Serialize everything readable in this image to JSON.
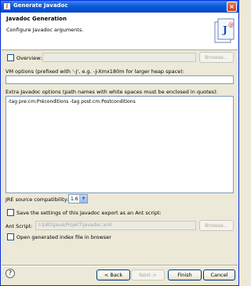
{
  "window": {
    "title": "Generate Javadoc"
  },
  "header": {
    "title": "Javadoc Generation",
    "subtitle": "Configure Javadoc arguments."
  },
  "overview": {
    "label": "Overview:",
    "value": "",
    "browse_label": "Browse..."
  },
  "vm_options": {
    "label": "VM options (prefixed with '-J', e.g. -J-Xmx180m for larger heap space):",
    "value": ""
  },
  "extra_options": {
    "label": "Extra Javadoc options (path names with white spaces must be enclosed in quotes):",
    "value": "-tag pre:cm:Préconditions -tag post:cm:Postconditions"
  },
  "jre": {
    "label": "JRE source compatibility:",
    "value": "1.6"
  },
  "save_settings": {
    "label": "Save the settings of this Javadoc export as an Ant script:"
  },
  "ant_script": {
    "label": "Ant Script:",
    "value": "I:\\LKO\\Java\\Projet7\\javadoc.xml",
    "browse_label": "Browse..."
  },
  "open_index": {
    "label": "Open generated index file in browser"
  },
  "buttons": {
    "back": "< Back",
    "next": "Next >",
    "finish": "Finish",
    "cancel": "Cancel"
  }
}
